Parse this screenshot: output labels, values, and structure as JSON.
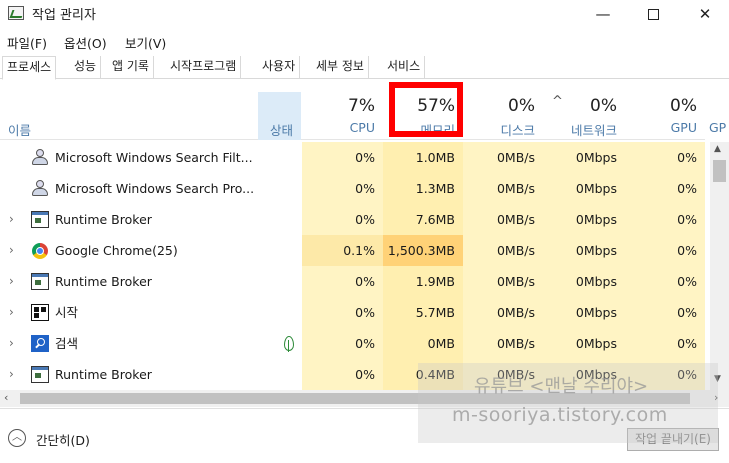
{
  "window": {
    "title": "작업 관리자",
    "minimize": "—",
    "close": "✕"
  },
  "menu": [
    "파일(F)",
    "옵션(O)",
    "보기(V)"
  ],
  "tabs": [
    "프로세스",
    "성능",
    "앱 기록",
    "시작프로그램",
    "사용자",
    "세부 정보",
    "서비스"
  ],
  "active_tab": "프로세스",
  "columns": {
    "name": "이름",
    "status": "상태",
    "cpu": {
      "pct": "7%",
      "label": "CPU"
    },
    "memory": {
      "pct": "57%",
      "label": "메모리"
    },
    "disk": {
      "pct": "0%",
      "label": "디스크"
    },
    "network": {
      "pct": "0%",
      "label": "네트워크"
    },
    "gpu": {
      "pct": "0%",
      "label": "GPU"
    },
    "gpu_engine": {
      "label": "GP"
    }
  },
  "sort_indicator": "^",
  "processes": [
    {
      "name": "Microsoft Windows Search Filt...",
      "icon": "user-icon",
      "expandable": false,
      "status": "",
      "cpu": "0%",
      "memory": "1.0MB",
      "disk": "0MB/s",
      "network": "0Mbps",
      "gpu": "0%"
    },
    {
      "name": "Microsoft Windows Search Pro...",
      "icon": "user-icon",
      "expandable": false,
      "status": "",
      "cpu": "0%",
      "memory": "1.3MB",
      "disk": "0MB/s",
      "network": "0Mbps",
      "gpu": "0%"
    },
    {
      "name": "Runtime Broker",
      "icon": "window-icon",
      "expandable": true,
      "status": "",
      "cpu": "0%",
      "memory": "7.6MB",
      "disk": "0MB/s",
      "network": "0Mbps",
      "gpu": "0%"
    },
    {
      "name": "Google Chrome(25)",
      "icon": "chrome-icon",
      "expandable": true,
      "status": "",
      "cpu": "0.1%",
      "memory": "1,500.3MB",
      "disk": "0MB/s",
      "network": "0Mbps",
      "gpu": "0%"
    },
    {
      "name": "Runtime Broker",
      "icon": "window-icon",
      "expandable": true,
      "status": "",
      "cpu": "0%",
      "memory": "1.9MB",
      "disk": "0MB/s",
      "network": "0Mbps",
      "gpu": "0%"
    },
    {
      "name": "시작",
      "icon": "start-icon",
      "expandable": true,
      "status": "",
      "cpu": "0%",
      "memory": "5.7MB",
      "disk": "0MB/s",
      "network": "0Mbps",
      "gpu": "0%"
    },
    {
      "name": "검색",
      "icon": "search-icon",
      "expandable": true,
      "status": "suspended-leaf-icon",
      "cpu": "0%",
      "memory": "0MB",
      "disk": "0MB/s",
      "network": "0Mbps",
      "gpu": "0%"
    },
    {
      "name": "Runtime Broker",
      "icon": "window-icon",
      "expandable": true,
      "status": "",
      "cpu": "0%",
      "memory": "0.4MB",
      "disk": "0MB/s",
      "network": "0Mbps",
      "gpu": "0%"
    }
  ],
  "footer": {
    "fewer_details": "간단히(D)",
    "end_task": "작업 끝내기(E)"
  },
  "watermark": {
    "line1": "유튜브 <맨날 수리야>",
    "line2": "m-sooriya.tistory.com"
  },
  "colors": {
    "highlight_box": "#ff0000",
    "cell_fill": "#fff4c4",
    "memory_hot": "#ffd277",
    "status_header": "#dcebf8"
  }
}
